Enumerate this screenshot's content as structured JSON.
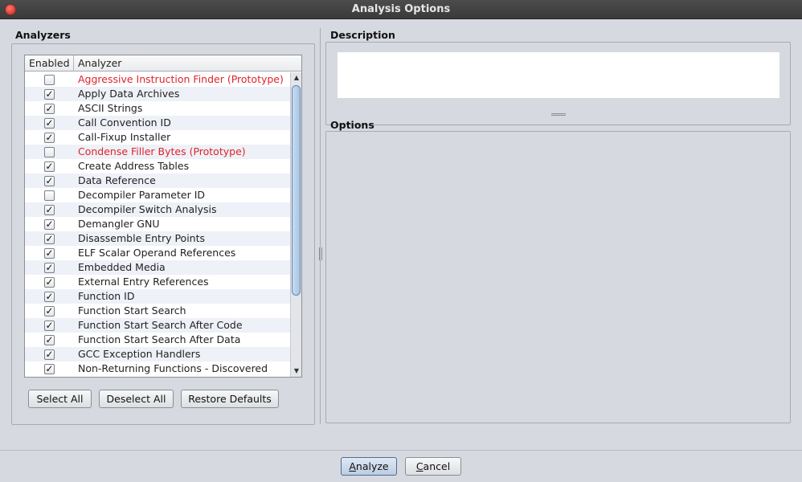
{
  "window": {
    "title": "Analysis Options"
  },
  "analyzers": {
    "section_title": "Analyzers",
    "columns": [
      "Enabled",
      "Analyzer"
    ],
    "rows": [
      {
        "enabled": false,
        "name": "Aggressive Instruction Finder (Prototype)",
        "prototype": true
      },
      {
        "enabled": true,
        "name": "Apply Data Archives",
        "prototype": false
      },
      {
        "enabled": true,
        "name": "ASCII Strings",
        "prototype": false
      },
      {
        "enabled": true,
        "name": "Call Convention ID",
        "prototype": false
      },
      {
        "enabled": true,
        "name": "Call-Fixup Installer",
        "prototype": false
      },
      {
        "enabled": false,
        "name": "Condense Filler Bytes (Prototype)",
        "prototype": true
      },
      {
        "enabled": true,
        "name": "Create Address Tables",
        "prototype": false
      },
      {
        "enabled": true,
        "name": "Data Reference",
        "prototype": false
      },
      {
        "enabled": false,
        "name": "Decompiler Parameter ID",
        "prototype": false
      },
      {
        "enabled": true,
        "name": "Decompiler Switch Analysis",
        "prototype": false
      },
      {
        "enabled": true,
        "name": "Demangler GNU",
        "prototype": false
      },
      {
        "enabled": true,
        "name": "Disassemble Entry Points",
        "prototype": false
      },
      {
        "enabled": true,
        "name": "ELF Scalar Operand References",
        "prototype": false
      },
      {
        "enabled": true,
        "name": "Embedded Media",
        "prototype": false
      },
      {
        "enabled": true,
        "name": "External Entry References",
        "prototype": false
      },
      {
        "enabled": true,
        "name": "Function ID",
        "prototype": false
      },
      {
        "enabled": true,
        "name": "Function Start Search",
        "prototype": false
      },
      {
        "enabled": true,
        "name": "Function Start Search After Code",
        "prototype": false
      },
      {
        "enabled": true,
        "name": "Function Start Search After Data",
        "prototype": false
      },
      {
        "enabled": true,
        "name": "GCC Exception Handlers",
        "prototype": false
      },
      {
        "enabled": true,
        "name": "Non-Returning Functions - Discovered",
        "prototype": false
      }
    ],
    "buttons": {
      "select_all": "Select All",
      "deselect_all": "Deselect All",
      "restore_defaults": "Restore Defaults"
    }
  },
  "description": {
    "section_title": "Description",
    "text": ""
  },
  "options": {
    "section_title": "Options"
  },
  "footer": {
    "analyze_label": "Analyze",
    "cancel_label": "Cancel"
  },
  "colors": {
    "prototype_text": "#e0232b",
    "row_alt": "#eef1f7",
    "accent": "#5e88b6"
  },
  "icons": {
    "close": "close-icon",
    "check": "check-icon",
    "scroll_up": "scroll-up-icon",
    "scroll_down": "scroll-down-icon"
  }
}
